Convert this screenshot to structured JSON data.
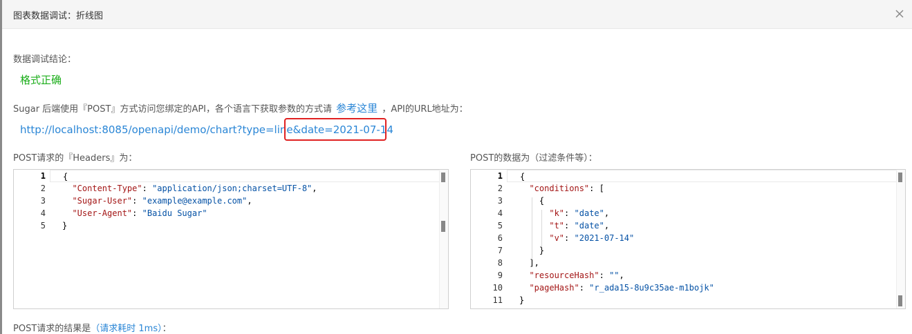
{
  "dialog": {
    "title": "图表数据调试：折线图"
  },
  "result": {
    "conclusion_label": "数据调试结论：",
    "status_text": "格式正确"
  },
  "description": {
    "prefix": "Sugar 后端使用『POST』方式访问您绑定的API，各个语言下获取参数的方式请",
    "link_text": "参考这里",
    "suffix": "，API的URL地址为："
  },
  "api": {
    "url": "http://localhost:8085/openapi/demo/chart?type=line&date=2021-07-14"
  },
  "headers_panel": {
    "label": "POST请求的『Headers』为：",
    "line_numbers": [
      "1",
      "2",
      "3",
      "4",
      "5"
    ],
    "lines": [
      "{",
      "  \"Content-Type\": \"application/json;charset=UTF-8\",",
      "  \"Sugar-User\": \"example@example.com\",",
      "  \"User-Agent\": \"Baidu Sugar\"",
      "}"
    ]
  },
  "body_panel": {
    "label": "POST的数据为（过滤条件等）：",
    "line_numbers": [
      "1",
      "2",
      "3",
      "4",
      "5",
      "6",
      "7",
      "8",
      "9",
      "10",
      "11"
    ],
    "lines": [
      "{",
      "  \"conditions\": [",
      "    {",
      "      \"k\": \"date\",",
      "      \"t\": \"date\",",
      "      \"v\": \"2021-07-14\"",
      "    }",
      "  ],",
      "  \"resourceHash\": \"\",",
      "  \"pageHash\": \"r_ada15-8u9c35ae-m1bojk\"",
      "}"
    ]
  },
  "footer": {
    "result_label": "POST请求的结果是",
    "timing_text": "（请求耗时 1ms）",
    "result_suffix": "："
  },
  "colors": {
    "success": "#1aad19",
    "link": "#2a86d6",
    "highlight": "#e02020",
    "json_key": "#a31515",
    "json_string": "#0451a5"
  }
}
